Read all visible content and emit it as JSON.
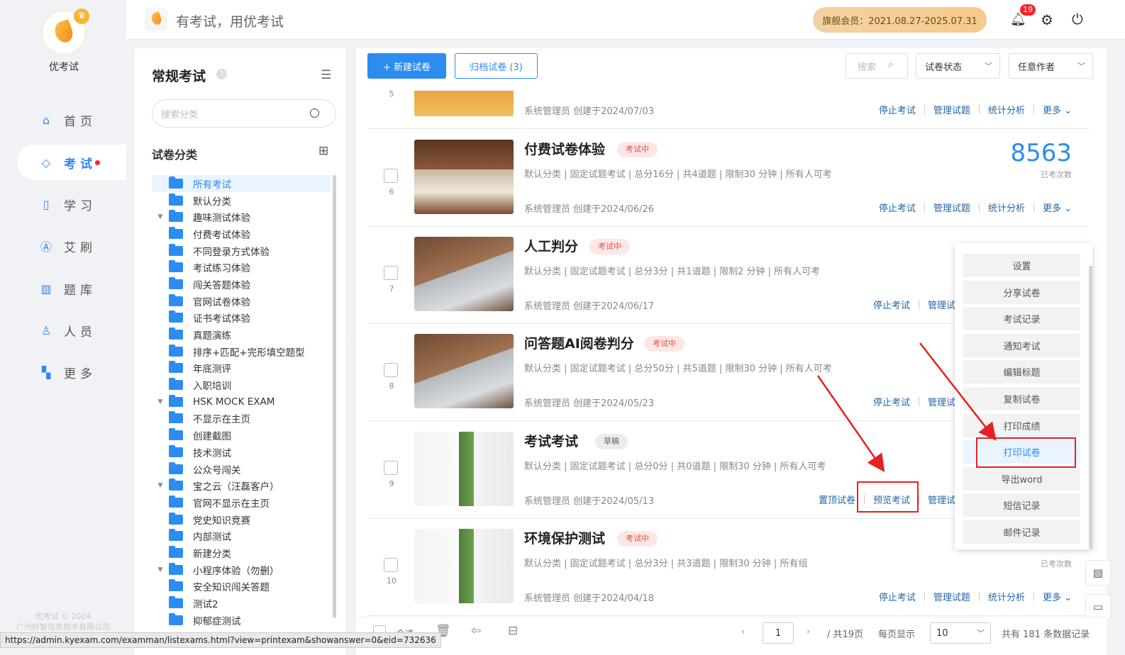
{
  "app": {
    "name": "优考试",
    "slogan": "有考试，用优考试",
    "copyright": "优考试 © 2024",
    "company": "广州好智信息技术有限公司"
  },
  "header": {
    "vip_text": "旗舰会员：2021.08.27-2025.07.31",
    "notification_count": "19",
    "bell_icon": "bell-icon",
    "settings_icon": "gear-icon",
    "logout_icon": "power-icon"
  },
  "nav": {
    "items": [
      {
        "label": "首页",
        "icon": "home-icon",
        "glyph": "⌂"
      },
      {
        "label": "考试",
        "icon": "exam-icon",
        "glyph": "◇"
      },
      {
        "label": "学习",
        "icon": "book-icon",
        "glyph": "▯"
      },
      {
        "label": "艾刷",
        "icon": "a-icon",
        "glyph": "Ⓐ"
      },
      {
        "label": "题库",
        "icon": "bank-icon",
        "glyph": "▥"
      },
      {
        "label": "人员",
        "icon": "user-icon",
        "glyph": "♙"
      },
      {
        "label": "更多",
        "icon": "more-icon",
        "glyph": "▚"
      }
    ]
  },
  "category": {
    "title": "常规考试",
    "search_placeholder": "搜索分类",
    "tree_title": "试卷分类",
    "items": [
      {
        "label": "所有考试",
        "caret": ""
      },
      {
        "label": "默认分类",
        "caret": ""
      },
      {
        "label": "趣味测试体验",
        "caret": "▼"
      },
      {
        "label": "付费考试体验",
        "caret": ""
      },
      {
        "label": "不同登录方式体验",
        "caret": ""
      },
      {
        "label": "考试练习体验",
        "caret": ""
      },
      {
        "label": "闯关答题体验",
        "caret": ""
      },
      {
        "label": "官网试卷体验",
        "caret": ""
      },
      {
        "label": "证书考试体验",
        "caret": ""
      },
      {
        "label": "真题演练",
        "caret": ""
      },
      {
        "label": "排序+匹配+完形填空题型",
        "caret": ""
      },
      {
        "label": "年底测评",
        "caret": ""
      },
      {
        "label": "入职培训",
        "caret": ""
      },
      {
        "label": "HSK MOCK EXAM",
        "caret": "▼"
      },
      {
        "label": "不显示在主页",
        "caret": ""
      },
      {
        "label": "创建截图",
        "caret": ""
      },
      {
        "label": "技术测试",
        "caret": ""
      },
      {
        "label": "公众号闯关",
        "caret": ""
      },
      {
        "label": "宝之云（汪磊客户）",
        "caret": "▼"
      },
      {
        "label": "官网不显示在主页",
        "caret": ""
      },
      {
        "label": "党史知识竞赛",
        "caret": ""
      },
      {
        "label": "内部测试",
        "caret": ""
      },
      {
        "label": "新建分类",
        "caret": ""
      },
      {
        "label": "小程序体验（勿删）",
        "caret": "▼"
      },
      {
        "label": "安全知识闯关答题",
        "caret": ""
      },
      {
        "label": "测试2",
        "caret": ""
      },
      {
        "label": "抑郁症测试",
        "caret": ""
      }
    ]
  },
  "toolbar": {
    "new_label": "+ 新建试卷",
    "archive_label": "归档试卷 (3)",
    "search_placeholder": "搜索",
    "status_select": "试卷状态",
    "author_select": "任意作者"
  },
  "exams": [
    {
      "idx": "5",
      "title": "",
      "tag": "",
      "meta": "",
      "creator": "系统管理员 创建于2024/07/03",
      "count": "",
      "count_label": "",
      "actions": [
        "停止考试",
        "管理试题",
        "统计分析",
        "更多"
      ]
    },
    {
      "idx": "6",
      "title": "付费试卷体验",
      "tag": "考试中",
      "meta": "默认分类 | 固定试题考试 | 总分16分 | 共4道题 | 限制30 分钟 | 所有人可考",
      "creator": "系统管理员 创建于2024/06/26",
      "count": "8563",
      "count_label": "已考次数",
      "actions": [
        "停止考试",
        "管理试题",
        "统计分析",
        "更多"
      ]
    },
    {
      "idx": "7",
      "title": "人工判分",
      "tag": "考试中",
      "meta": "默认分类 | 固定试题考试 | 总分3分 | 共1道题 | 限制2 分钟 | 所有人可考",
      "creator": "系统管理员 创建于2024/06/17",
      "count": "",
      "count_label": "",
      "actions": [
        "停止考试",
        "管理试"
      ]
    },
    {
      "idx": "8",
      "title": "问答题AI阅卷判分",
      "tag": "考试中",
      "meta": "默认分类 | 固定试题考试 | 总分50分 | 共5道题 | 限制30 分钟 | 所有人可考",
      "creator": "系统管理员 创建于2024/05/23",
      "count": "",
      "count_label": "",
      "actions": [
        "停止考试",
        "管理试"
      ]
    },
    {
      "idx": "9",
      "title": "考试考试",
      "tag": "草稿",
      "meta": "默认分类 | 固定试题考试 | 总分0分 | 共0道题 | 限制30 分钟 | 所有人可考",
      "creator": "系统管理员 创建于2024/05/13",
      "count": "",
      "count_label": "",
      "actions": [
        "置顶试卷",
        "预览考试",
        "管理试"
      ]
    },
    {
      "idx": "10",
      "title": "环境保护测试",
      "tag": "考试中",
      "meta": "默认分类 | 固定试题考试 | 总分3分 | 共3道题 | 限制30 分钟 | 所有组",
      "creator": "系统管理员 创建于2024/04/18",
      "count": "",
      "count_label": "已考次数",
      "actions": [
        "停止考试",
        "管理试题",
        "统计分析",
        "更多"
      ]
    }
  ],
  "menu": {
    "items": [
      "设置",
      "分享试卷",
      "考试记录",
      "通知考试",
      "编辑标题",
      "复制试卷",
      "打印成绩",
      "打印试卷",
      "导出word",
      "短信记录",
      "邮件记录"
    ],
    "highlighted": "打印试卷"
  },
  "footer": {
    "select_all": "全选",
    "page": "1",
    "total_pages": "/ 共19页",
    "per_page_label": "每页显示",
    "per_page": "10",
    "total": "共有 181 条数据记录"
  },
  "statusbar": {
    "url": "https://admin.kyexam.com/examman/listexams.html?view=printexam&showanswer=0&eid=732636"
  },
  "colors": {
    "accent": "#2d8cf0",
    "danger": "#e52222",
    "vip": "#f6c98c"
  }
}
